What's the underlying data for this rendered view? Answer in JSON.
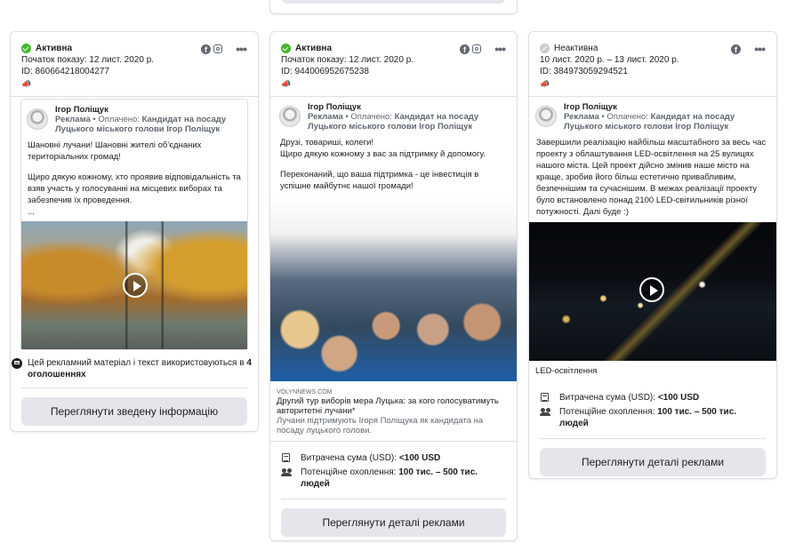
{
  "cards": [
    {
      "status": "Активна",
      "start": "Початок показу: 12 лист. 2020 р.",
      "id": "ID: 860664218004277",
      "platforms": [
        "facebook-icon",
        "instagram-icon"
      ],
      "author": "Ігор Поліщук",
      "sponsor_prefix": "Реклама",
      "paid_label": "Оплачено:",
      "sponsor": "Кандидат на посаду Луцького міського голови Ігор Поліщук",
      "text": [
        "Шановні лучани! Шановні жителі об'єднаних територіальних громад!",
        "Щиро дякую кожному, хто проявив відповідальність та взяв участь у голосуванні на місцевих виборах та забезпечив їх проведення.",
        "..."
      ],
      "multi_ads_text": "Цей рекламний матеріал і текст використовуються в",
      "multi_ads_count": "4 оголошеннях",
      "button": "Переглянути зведену інформацію"
    },
    {
      "status": "Активна",
      "start": "Початок показу: 12 лист. 2020 р.",
      "id": "ID: 944006952675238",
      "platforms": [
        "facebook-icon",
        "instagram-icon"
      ],
      "author": "Ігор Поліщук",
      "sponsor_prefix": "Реклама",
      "paid_label": "Оплачено:",
      "sponsor": "Кандидат на посаду Луцького міського голови Ігор Поліщук",
      "text": [
        "Друзі, товариші, колеги!\nЩиро дякую кожному з вас за підтримку й допомогу.",
        "Переконаний, що ваша підтримка - це інвестиція в успішне майбутнє нашої громади!"
      ],
      "link": {
        "domain": "VOLYNNEWS.COM",
        "title": "Другий тур виборів мера Луцька: за кого голосуватимуть авторитетні лучани*",
        "desc": "Лучани підтримують Ігоря Поліщука як кандидата на посаду луцького голови."
      },
      "spent_label": "Витрачена сума (USD):",
      "spent_value": "<100 USD",
      "reach_label": "Потенційне охоплення:",
      "reach_value": "100 тис. – 500 тис. людей",
      "button": "Переглянути деталі реклами"
    },
    {
      "status": "Неактивна",
      "start": "10 лист. 2020 р. – 13 лист. 2020 р.",
      "id": "ID: 384973059294521",
      "platforms": [
        "facebook-icon"
      ],
      "author": "Ігор Поліщук",
      "sponsor_prefix": "Реклама",
      "paid_label": "Оплачено:",
      "sponsor": "Кандидат на посаду Луцького міського голови Ігор Поліщук",
      "text": [
        "Завершили реалізацію найбільш масштабного за весь час проекту з облаштування LED-освітлення на 25 вулицях нашого міста. Цей проект дійсно змінив наше місто на краще, зробив його більш естетично привабливим, безпечнішим та сучаснішим. В межах реалізації проекту було встановлено понад 2100 LED-світильників різної потужності. Далі буде :)"
      ],
      "caption": "LED-освітлення",
      "spent_label": "Витрачена сума (USD):",
      "spent_value": "<100 USD",
      "reach_label": "Потенційне охоплення:",
      "reach_value": "100 тис. – 500 тис. людей",
      "button": "Переглянути деталі реклами"
    }
  ],
  "more_menu": "•••"
}
